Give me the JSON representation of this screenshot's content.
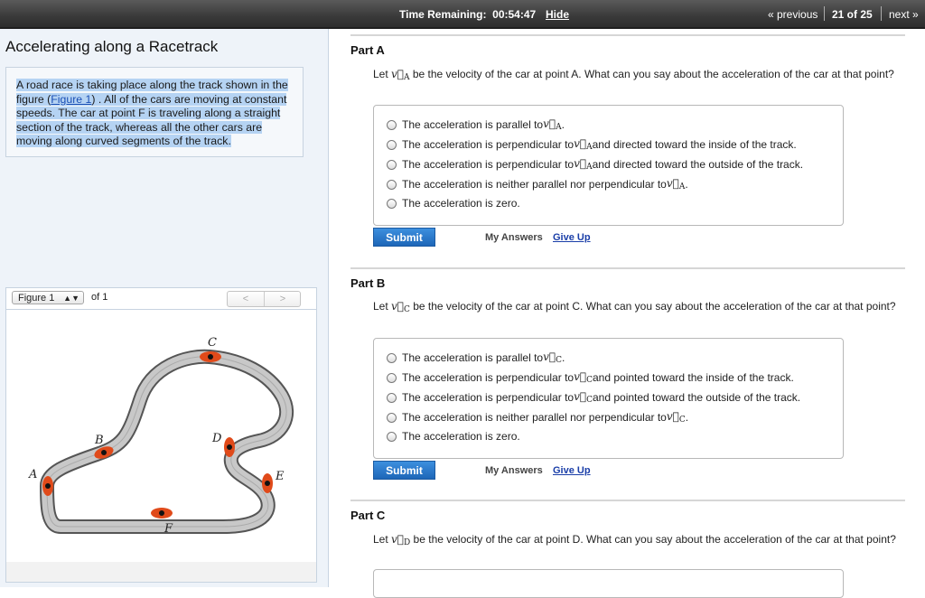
{
  "topbar": {
    "timer_label": "Time Remaining:",
    "timer_value": "00:54:47",
    "hide_label": "Hide",
    "prev_label": "« previous",
    "count_label": "21 of 25",
    "next_label": "next »"
  },
  "problem": {
    "title": "Accelerating along a Racetrack",
    "intro_before": "A road race is taking place along the track shown in the figure (",
    "figure_link": "Figure 1",
    "intro_after": ") . All of the cars are moving at constant speeds. The car at point F is traveling along a straight section of the track, whereas all the other cars are moving along curved segments of the track."
  },
  "figure": {
    "selector_value": "Figure 1",
    "of_label": "of 1",
    "prev_arrow": "<",
    "next_arrow": ">",
    "point_labels": [
      "A",
      "B",
      "C",
      "D",
      "E",
      "F"
    ]
  },
  "parts": [
    {
      "label": "Part A",
      "question_before": "Let ",
      "vec_sub": "A",
      "question_after": " be the velocity of the car at point A. What can you say about the acceleration of the car at that point?",
      "choices": [
        {
          "pre": "The acceleration is parallel to ",
          "post": "."
        },
        {
          "pre": "The acceleration is perpendicular to ",
          "post": " and directed toward the inside of the track."
        },
        {
          "pre": "The acceleration is perpendicular to ",
          "post": " and directed toward the outside of the track."
        },
        {
          "pre": "The acceleration is neither parallel nor perpendicular to ",
          "post": "."
        },
        {
          "pre": "The acceleration is zero.",
          "post": ""
        }
      ],
      "submit_label": "Submit",
      "my_answers_label": "My Answers",
      "give_up_label": "Give Up"
    },
    {
      "label": "Part B",
      "question_before": "Let ",
      "vec_sub": "C",
      "question_after": " be the velocity of the car at point C. What can you say about the acceleration of the car at that point?",
      "choices": [
        {
          "pre": "The acceleration is parallel to ",
          "post": "."
        },
        {
          "pre": "The acceleration is perpendicular to ",
          "post": " and pointed toward the inside of the track."
        },
        {
          "pre": "The acceleration is perpendicular to ",
          "post": " and pointed toward the outside of the track."
        },
        {
          "pre": "The acceleration is neither parallel nor perpendicular to ",
          "post": "."
        },
        {
          "pre": "The acceleration is zero.",
          "post": ""
        }
      ],
      "submit_label": "Submit",
      "my_answers_label": "My Answers",
      "give_up_label": "Give Up"
    },
    {
      "label": "Part C",
      "question_before": "Let ",
      "vec_sub": "D",
      "question_after": " be the velocity of the car at point D. What can you say about the acceleration of the car at that point?"
    }
  ],
  "vector_symbol": "v⃗"
}
